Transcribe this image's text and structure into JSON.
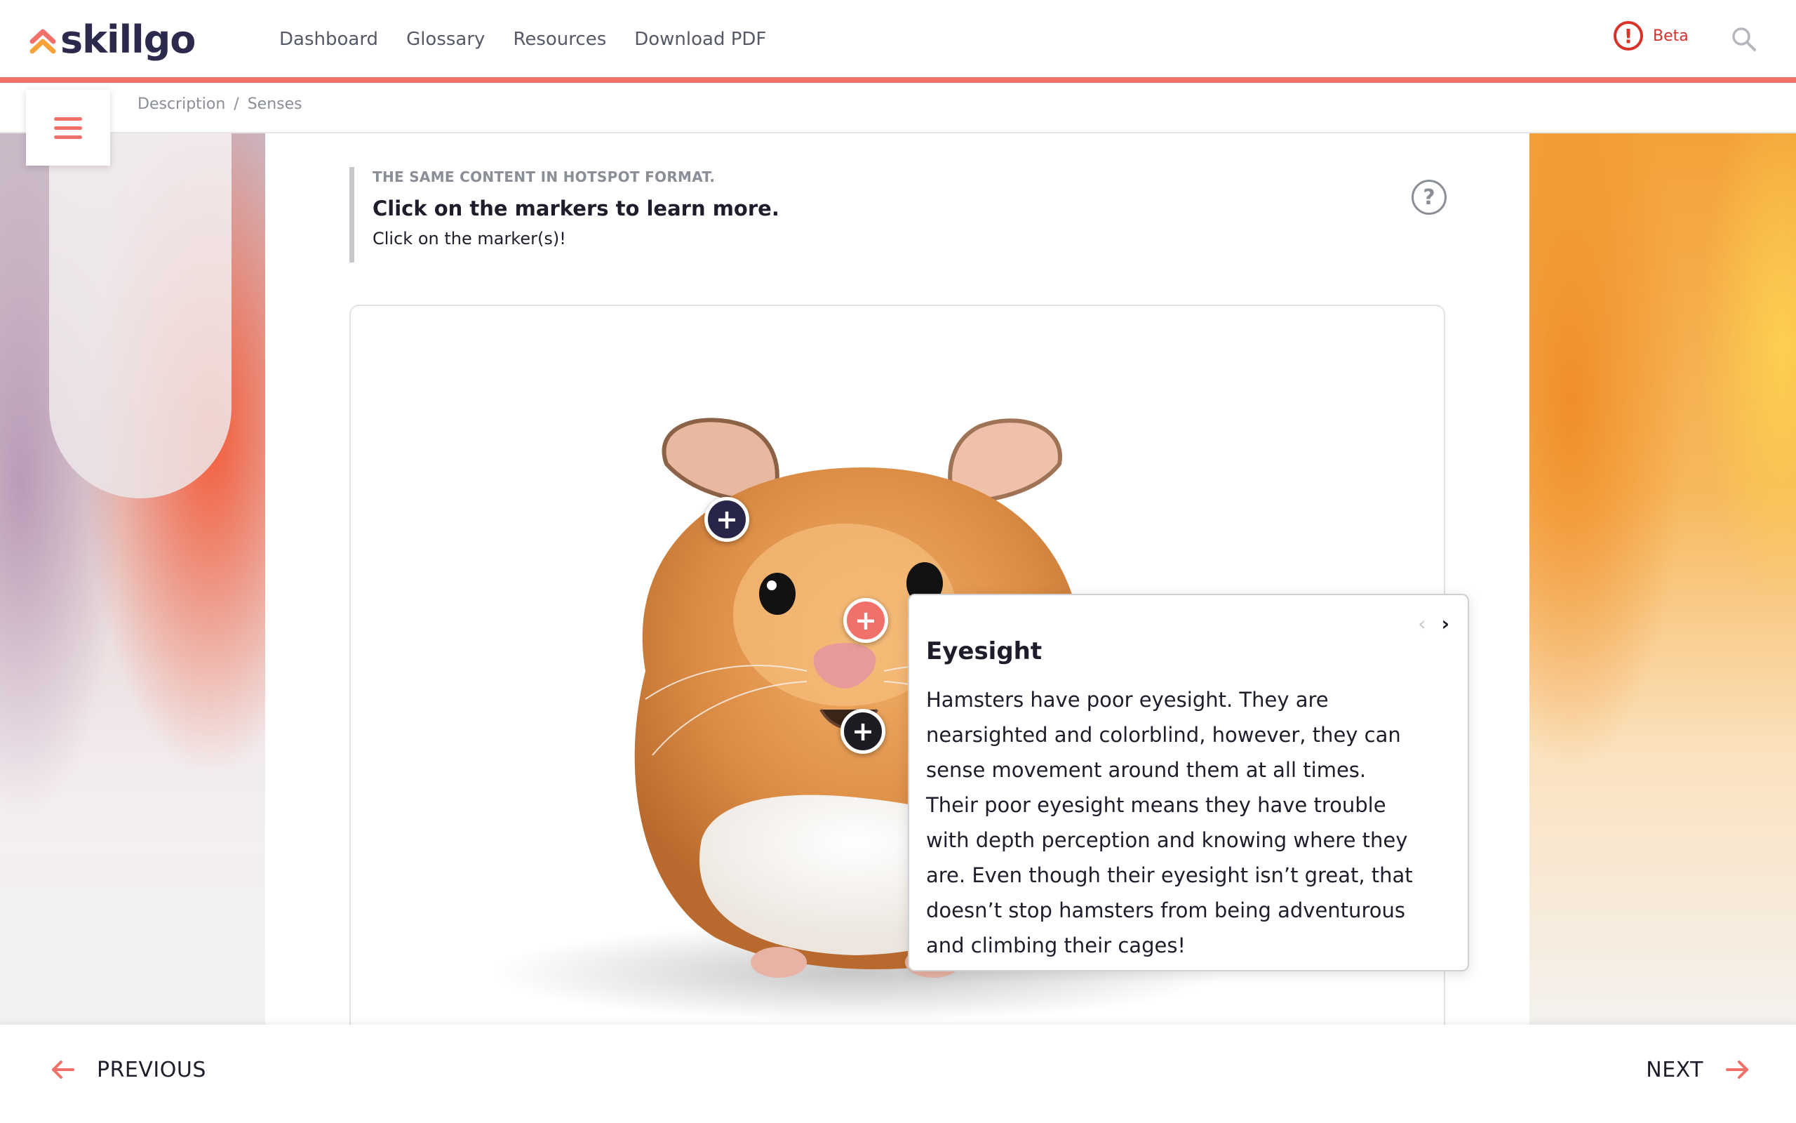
{
  "brand": {
    "name": "skillgo"
  },
  "nav": {
    "items": [
      {
        "label": "Dashboard"
      },
      {
        "label": "Glossary"
      },
      {
        "label": "Resources"
      },
      {
        "label": "Download PDF"
      }
    ]
  },
  "beta": {
    "icon": "alert-circle-icon",
    "label": "Beta"
  },
  "search": {
    "icon": "search-icon"
  },
  "breadcrumb": {
    "items": [
      "Description",
      "Senses"
    ],
    "separator": "/"
  },
  "instruction": {
    "kicker": "THE SAME CONTENT IN HOTSPOT FORMAT.",
    "title": "Click on the markers to learn more.",
    "subtitle": "Click on the marker(s)!"
  },
  "help": {
    "label": "?"
  },
  "hotspots": [
    {
      "name": "ear",
      "symbol": "+",
      "state": "default"
    },
    {
      "name": "eye",
      "symbol": "+",
      "state": "active"
    },
    {
      "name": "mouth",
      "symbol": "+",
      "state": "default"
    }
  ],
  "popup": {
    "prev_symbol": "‹",
    "next_symbol": "›",
    "title": "Eyesight",
    "body": "Hamsters have poor eyesight. They are nearsighted and colorblind, however, they can sense movement around them at all times. Their poor eyesight means they have trouble with depth perception and knowing where they are. Even though their eyesight isn’t great, that doesn’t stop hamsters from being adventurous and climbing their cages!"
  },
  "footer": {
    "previous_label": "PREVIOUS",
    "next_label": "NEXT"
  },
  "colors": {
    "accent": "#f0706a",
    "brand_dark": "#2b2a4c",
    "alert": "#d8322a",
    "text": "#1d1d2b",
    "muted": "#8a8e96"
  }
}
